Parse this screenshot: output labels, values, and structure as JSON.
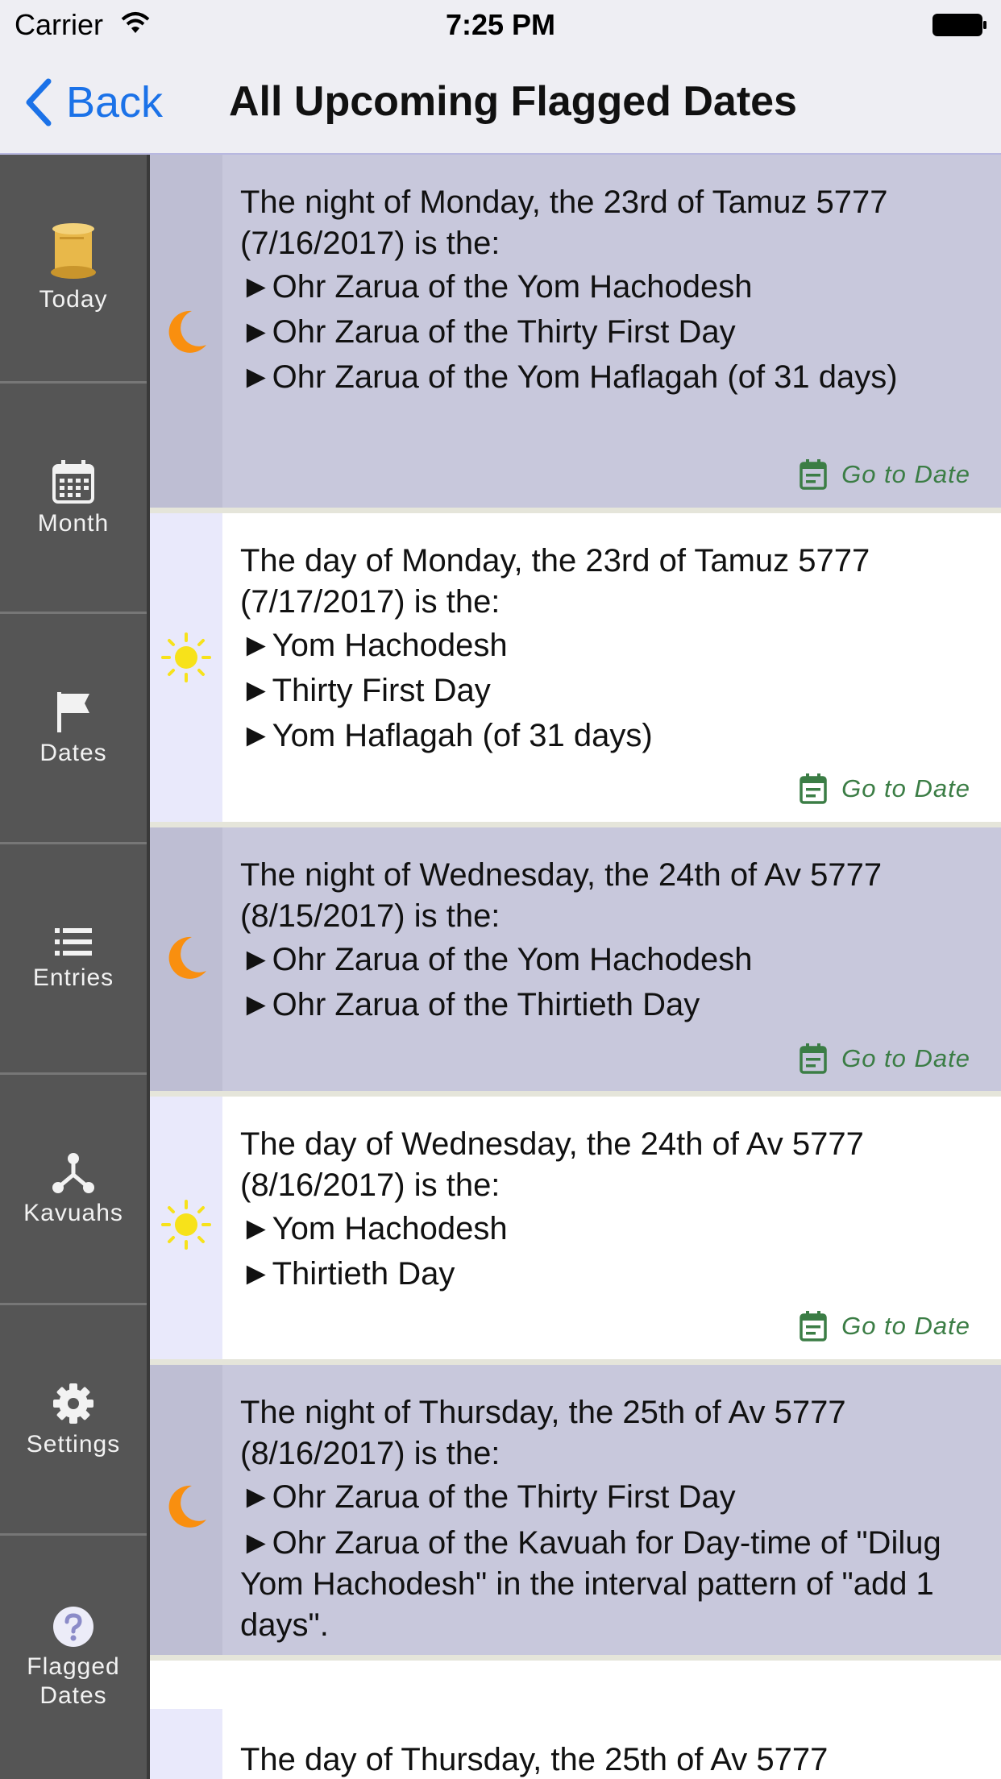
{
  "status_bar": {
    "carrier": "Carrier",
    "time": "7:25 PM",
    "wifi_icon": "wifi-icon",
    "battery_icon": "battery-icon"
  },
  "nav": {
    "back_label": "Back",
    "title": "All Upcoming Flagged Dates"
  },
  "sidebar": {
    "items": [
      {
        "label": "Today",
        "icon": "scroll-icon"
      },
      {
        "label": "Month",
        "icon": "calendar-icon"
      },
      {
        "label": "Dates",
        "icon": "flag-icon"
      },
      {
        "label": "Entries",
        "icon": "list-icon"
      },
      {
        "label": "Kavuahs",
        "icon": "network-icon"
      },
      {
        "label": "Settings",
        "icon": "gear-icon"
      },
      {
        "label": "Flagged Dates",
        "icon": "question-icon"
      }
    ]
  },
  "entries": [
    {
      "time_of_day": "night",
      "heading": "The night of Monday, the 23rd of Tamuz 5777 (7/16/2017) is the:",
      "items": [
        "►Ohr Zarua of the Yom Hachodesh",
        "►Ohr Zarua of the Thirty First Day",
        "►Ohr Zarua of the Yom Haflagah (of 31 days)"
      ],
      "goto_label": "Go to Date"
    },
    {
      "time_of_day": "day",
      "heading": "The day of Monday, the 23rd of Tamuz 5777 (7/17/2017) is the:",
      "items": [
        "►Yom Hachodesh",
        "►Thirty First Day",
        "►Yom Haflagah (of 31 days)"
      ],
      "goto_label": "Go to Date"
    },
    {
      "time_of_day": "night",
      "heading": "The night of Wednesday, the 24th of Av 5777 (8/15/2017) is the:",
      "items": [
        "►Ohr Zarua of the Yom Hachodesh",
        "►Ohr Zarua of the Thirtieth Day"
      ],
      "goto_label": "Go to Date"
    },
    {
      "time_of_day": "day",
      "heading": "The day of Wednesday, the 24th of Av 5777 (8/16/2017) is the:",
      "items": [
        "►Yom Hachodesh",
        "►Thirtieth Day"
      ],
      "goto_label": "Go to Date"
    },
    {
      "time_of_day": "night",
      "heading": "The night of Thursday, the 25th of Av 5777 (8/16/2017) is the:",
      "items": [
        "►Ohr Zarua of the Thirty First Day",
        "►Ohr Zarua of the Kavuah for Day-time of \"Dilug Yom Hachodesh\" in the interval pattern of \"add 1 days\"."
      ],
      "goto_label": ""
    },
    {
      "time_of_day": "day",
      "heading": "The day of Thursday, the 25th of Av 5777",
      "items": [],
      "goto_label": ""
    }
  ]
}
